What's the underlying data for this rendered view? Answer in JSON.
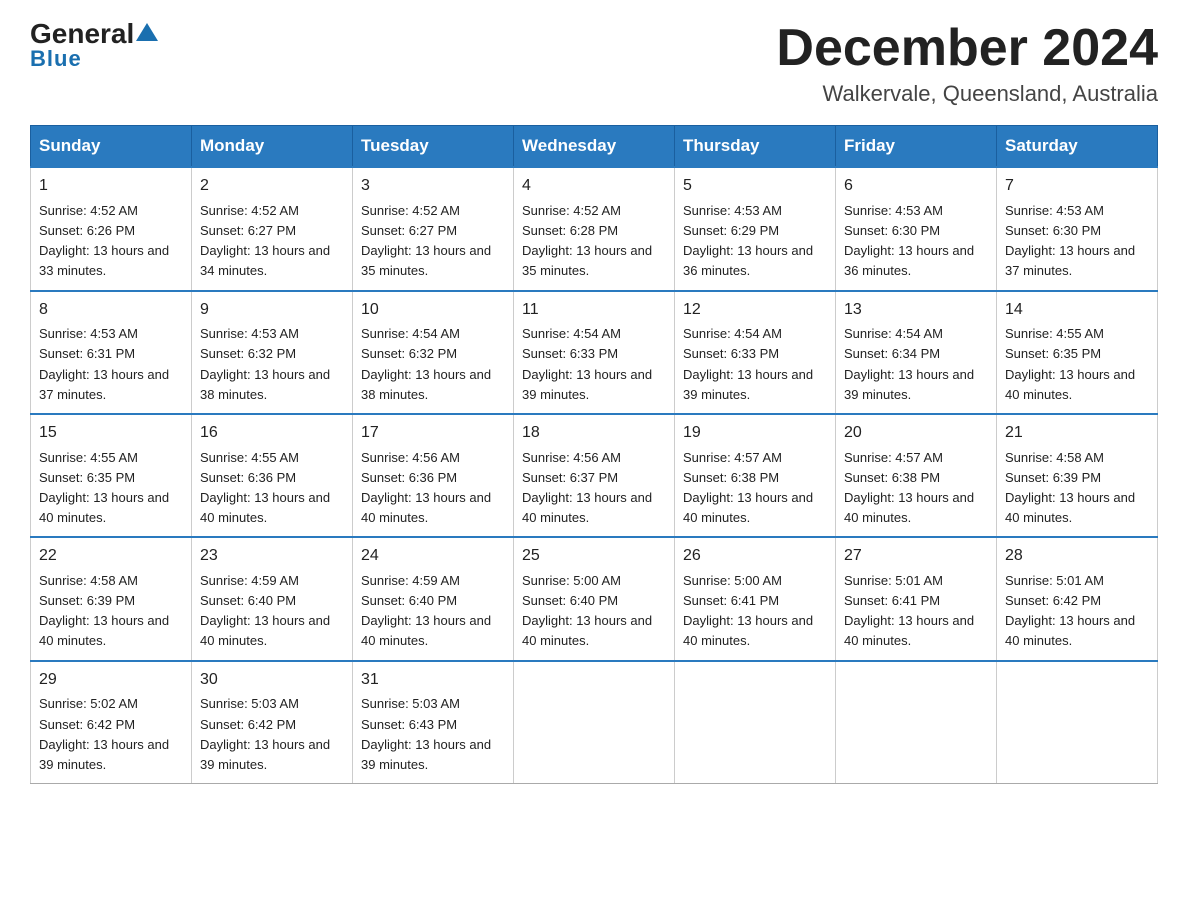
{
  "header": {
    "logo": {
      "general": "General",
      "triangle": "▲",
      "blue": "Blue"
    },
    "title": "December 2024",
    "location": "Walkervale, Queensland, Australia"
  },
  "calendar": {
    "days": [
      "Sunday",
      "Monday",
      "Tuesday",
      "Wednesday",
      "Thursday",
      "Friday",
      "Saturday"
    ],
    "weeks": [
      [
        {
          "date": "1",
          "sunrise": "4:52 AM",
          "sunset": "6:26 PM",
          "daylight": "13 hours and 33 minutes."
        },
        {
          "date": "2",
          "sunrise": "4:52 AM",
          "sunset": "6:27 PM",
          "daylight": "13 hours and 34 minutes."
        },
        {
          "date": "3",
          "sunrise": "4:52 AM",
          "sunset": "6:27 PM",
          "daylight": "13 hours and 35 minutes."
        },
        {
          "date": "4",
          "sunrise": "4:52 AM",
          "sunset": "6:28 PM",
          "daylight": "13 hours and 35 minutes."
        },
        {
          "date": "5",
          "sunrise": "4:53 AM",
          "sunset": "6:29 PM",
          "daylight": "13 hours and 36 minutes."
        },
        {
          "date": "6",
          "sunrise": "4:53 AM",
          "sunset": "6:30 PM",
          "daylight": "13 hours and 36 minutes."
        },
        {
          "date": "7",
          "sunrise": "4:53 AM",
          "sunset": "6:30 PM",
          "daylight": "13 hours and 37 minutes."
        }
      ],
      [
        {
          "date": "8",
          "sunrise": "4:53 AM",
          "sunset": "6:31 PM",
          "daylight": "13 hours and 37 minutes."
        },
        {
          "date": "9",
          "sunrise": "4:53 AM",
          "sunset": "6:32 PM",
          "daylight": "13 hours and 38 minutes."
        },
        {
          "date": "10",
          "sunrise": "4:54 AM",
          "sunset": "6:32 PM",
          "daylight": "13 hours and 38 minutes."
        },
        {
          "date": "11",
          "sunrise": "4:54 AM",
          "sunset": "6:33 PM",
          "daylight": "13 hours and 39 minutes."
        },
        {
          "date": "12",
          "sunrise": "4:54 AM",
          "sunset": "6:33 PM",
          "daylight": "13 hours and 39 minutes."
        },
        {
          "date": "13",
          "sunrise": "4:54 AM",
          "sunset": "6:34 PM",
          "daylight": "13 hours and 39 minutes."
        },
        {
          "date": "14",
          "sunrise": "4:55 AM",
          "sunset": "6:35 PM",
          "daylight": "13 hours and 40 minutes."
        }
      ],
      [
        {
          "date": "15",
          "sunrise": "4:55 AM",
          "sunset": "6:35 PM",
          "daylight": "13 hours and 40 minutes."
        },
        {
          "date": "16",
          "sunrise": "4:55 AM",
          "sunset": "6:36 PM",
          "daylight": "13 hours and 40 minutes."
        },
        {
          "date": "17",
          "sunrise": "4:56 AM",
          "sunset": "6:36 PM",
          "daylight": "13 hours and 40 minutes."
        },
        {
          "date": "18",
          "sunrise": "4:56 AM",
          "sunset": "6:37 PM",
          "daylight": "13 hours and 40 minutes."
        },
        {
          "date": "19",
          "sunrise": "4:57 AM",
          "sunset": "6:38 PM",
          "daylight": "13 hours and 40 minutes."
        },
        {
          "date": "20",
          "sunrise": "4:57 AM",
          "sunset": "6:38 PM",
          "daylight": "13 hours and 40 minutes."
        },
        {
          "date": "21",
          "sunrise": "4:58 AM",
          "sunset": "6:39 PM",
          "daylight": "13 hours and 40 minutes."
        }
      ],
      [
        {
          "date": "22",
          "sunrise": "4:58 AM",
          "sunset": "6:39 PM",
          "daylight": "13 hours and 40 minutes."
        },
        {
          "date": "23",
          "sunrise": "4:59 AM",
          "sunset": "6:40 PM",
          "daylight": "13 hours and 40 minutes."
        },
        {
          "date": "24",
          "sunrise": "4:59 AM",
          "sunset": "6:40 PM",
          "daylight": "13 hours and 40 minutes."
        },
        {
          "date": "25",
          "sunrise": "5:00 AM",
          "sunset": "6:40 PM",
          "daylight": "13 hours and 40 minutes."
        },
        {
          "date": "26",
          "sunrise": "5:00 AM",
          "sunset": "6:41 PM",
          "daylight": "13 hours and 40 minutes."
        },
        {
          "date": "27",
          "sunrise": "5:01 AM",
          "sunset": "6:41 PM",
          "daylight": "13 hours and 40 minutes."
        },
        {
          "date": "28",
          "sunrise": "5:01 AM",
          "sunset": "6:42 PM",
          "daylight": "13 hours and 40 minutes."
        }
      ],
      [
        {
          "date": "29",
          "sunrise": "5:02 AM",
          "sunset": "6:42 PM",
          "daylight": "13 hours and 39 minutes."
        },
        {
          "date": "30",
          "sunrise": "5:03 AM",
          "sunset": "6:42 PM",
          "daylight": "13 hours and 39 minutes."
        },
        {
          "date": "31",
          "sunrise": "5:03 AM",
          "sunset": "6:43 PM",
          "daylight": "13 hours and 39 minutes."
        },
        null,
        null,
        null,
        null
      ]
    ]
  }
}
